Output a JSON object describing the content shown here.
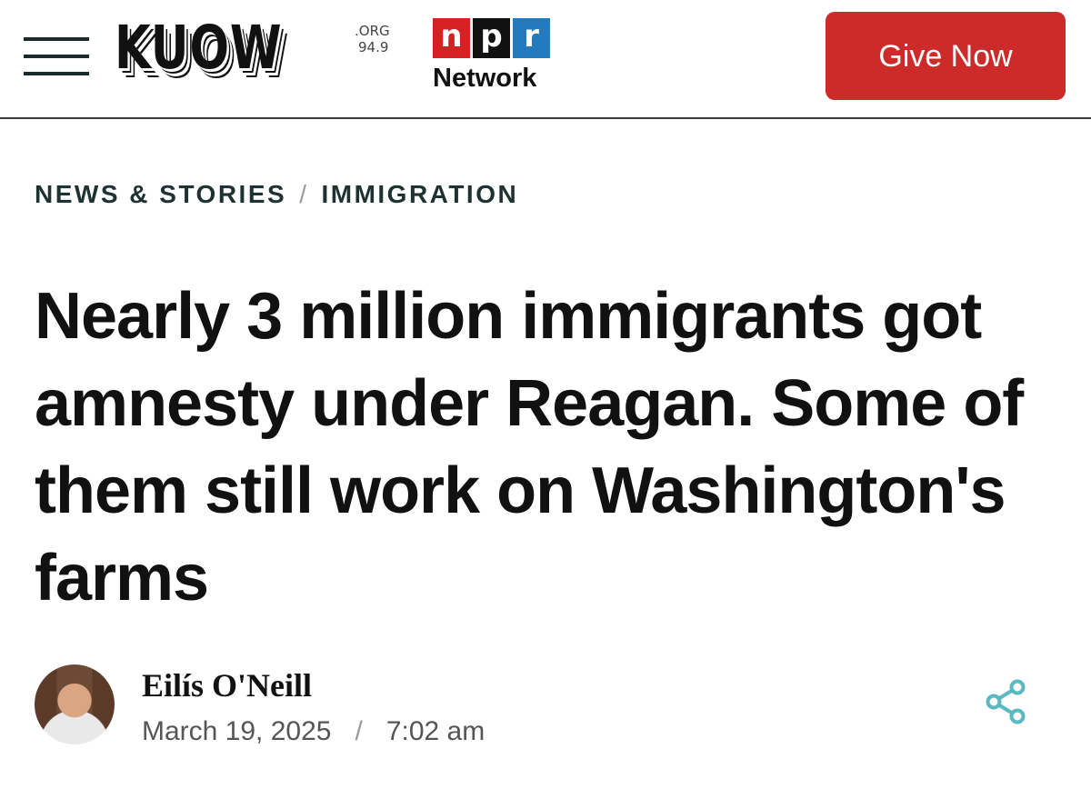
{
  "header": {
    "brand": {
      "name": "KUOW",
      "domain": ".ORG",
      "frequency": "94.9"
    },
    "network": {
      "letters": [
        "n",
        "p",
        "r"
      ],
      "label": "Network"
    },
    "give_button": "Give Now",
    "colors": {
      "give_button": "#cd2b2a",
      "npr_n": "#d62021",
      "npr_p": "#111111",
      "npr_r": "#237bbd"
    }
  },
  "breadcrumb": {
    "items": [
      "NEWS & STORIES",
      "IMMIGRATION"
    ],
    "separator": "/"
  },
  "article": {
    "headline": "Nearly 3 million immigrants got amnesty under Reagan. Some of them still work on Washington's farms",
    "author": "Eilís O'Neill",
    "date": "March 19, 2025",
    "date_separator": "/",
    "time": "7:02 am"
  },
  "icons": {
    "menu": "hamburger-menu-icon",
    "share": "share-icon",
    "share_color": "#5bb8c0"
  }
}
